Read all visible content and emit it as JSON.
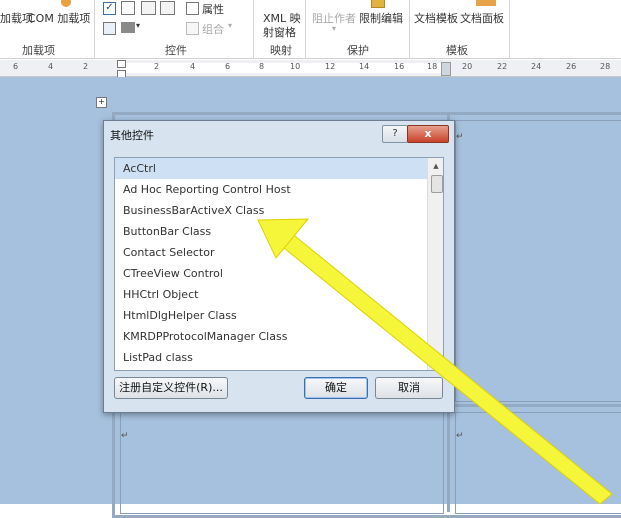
{
  "ribbon": {
    "btn_addins": "加载项",
    "btn_com": "COM 加载项",
    "grp_addins": "加载项",
    "properties": "属性",
    "group_btn": "组合",
    "grp_controls": "控件",
    "xml_mapping_line1": "XML 映",
    "xml_mapping_line2": "射窗格",
    "grp_mapping": "映射",
    "block_authors": "阻止作者",
    "restrict_editing": "限制编辑",
    "grp_protect": "保护",
    "doc_template": "文档模板",
    "doc_panel": "文档面板",
    "grp_templates": "模板"
  },
  "ruler": {
    "numbers": [
      "6",
      "4",
      "2",
      "2",
      "4",
      "6",
      "8",
      "10",
      "12",
      "14",
      "16",
      "18",
      "20",
      "22",
      "24",
      "26",
      "28"
    ]
  },
  "dialog": {
    "title": "其他控件",
    "help": "?",
    "close": "x",
    "items": [
      "AcCtrl",
      "Ad Hoc Reporting Control Host",
      "BusinessBarActiveX Class",
      "ButtonBar Class",
      "Contact Selector",
      "CTreeView Control",
      "HHCtrl Object",
      "HtmlDlgHelper Class",
      "KMRDPProtocolManager  Class",
      "ListPad class"
    ],
    "selected_index": 0,
    "register_btn": "注册自定义控件(R)...",
    "ok_btn": "确定",
    "cancel_btn": "取消"
  },
  "colors": {
    "doc_background": "#a6c1de",
    "selection": "#cde0f4",
    "arrow": "#f5f53a"
  }
}
